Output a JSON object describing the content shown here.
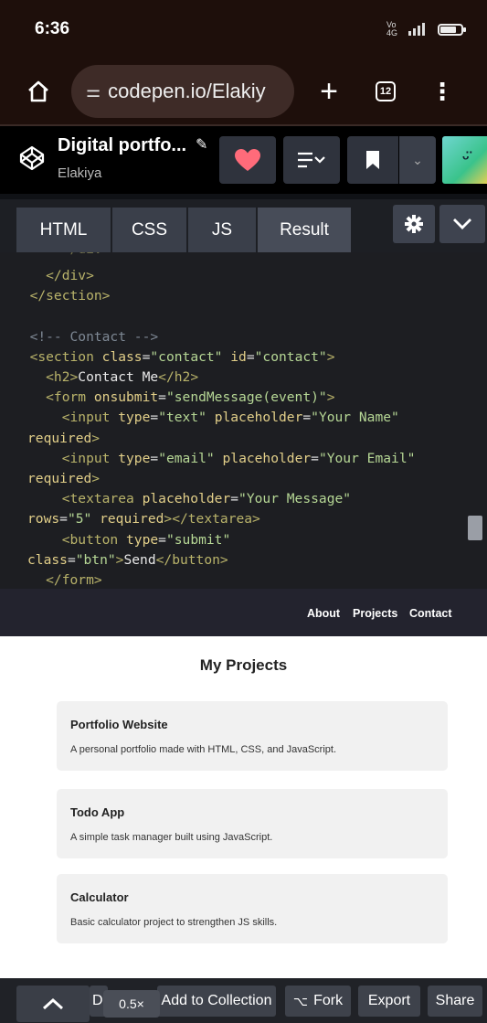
{
  "status_bar": {
    "time": "6:36",
    "network": "Vo 4G",
    "signal": "4G",
    "battery_level": 0.75
  },
  "browser": {
    "url": "codepen.io/Elakiy",
    "tab_count": "12"
  },
  "pen": {
    "title": "Digital portfo...",
    "author": "Elakiya"
  },
  "editor_tabs": [
    "HTML",
    "CSS",
    "JS",
    "Result"
  ],
  "code_lines": [
    [
      [
        "tok-cont",
        "      </div>"
      ]
    ],
    [
      [
        "tok-tag",
        "    </div>"
      ]
    ],
    [
      [
        "tok-tag",
        "  </section>"
      ]
    ],
    [
      [
        "tok-text",
        ""
      ]
    ],
    [
      [
        "tok-comment",
        "  <!-- Contact -->"
      ]
    ],
    [
      [
        "tok-tag",
        "  <section "
      ],
      [
        "tok-attr",
        "class"
      ],
      [
        "tok-text",
        "="
      ],
      [
        "tok-str",
        "\"contact\""
      ],
      [
        "tok-text",
        " "
      ],
      [
        "tok-attr",
        "id"
      ],
      [
        "tok-text",
        "="
      ],
      [
        "tok-str",
        "\"contact\""
      ],
      [
        "tok-tag",
        ">"
      ]
    ],
    [
      [
        "tok-tag",
        "    <h2>"
      ],
      [
        "tok-text",
        "Contact Me"
      ],
      [
        "tok-tag",
        "</h2>"
      ]
    ],
    [
      [
        "tok-tag",
        "    <form "
      ],
      [
        "tok-attr",
        "onsubmit"
      ],
      [
        "tok-text",
        "="
      ],
      [
        "tok-str",
        "\"sendMessage(event)\""
      ],
      [
        "tok-tag",
        ">"
      ]
    ],
    [
      [
        "tok-tag",
        "      <input "
      ],
      [
        "tok-attr",
        "type"
      ],
      [
        "tok-text",
        "="
      ],
      [
        "tok-str",
        "\"text\""
      ],
      [
        "tok-text",
        " "
      ],
      [
        "tok-attr",
        "placeholder"
      ],
      [
        "tok-text",
        "="
      ],
      [
        "tok-str",
        "\"Your Name\""
      ]
    ],
    [
      [
        "tok-attr",
        "required"
      ],
      [
        "tok-tag",
        ">"
      ]
    ],
    [
      [
        "tok-tag",
        "      <input "
      ],
      [
        "tok-attr",
        "type"
      ],
      [
        "tok-text",
        "="
      ],
      [
        "tok-str",
        "\"email\""
      ],
      [
        "tok-text",
        " "
      ],
      [
        "tok-attr",
        "placeholder"
      ],
      [
        "tok-text",
        "="
      ],
      [
        "tok-str",
        "\"Your Email\""
      ]
    ],
    [
      [
        "tok-attr",
        "required"
      ],
      [
        "tok-tag",
        ">"
      ]
    ],
    [
      [
        "tok-tag",
        "      <textarea "
      ],
      [
        "tok-attr",
        "placeholder"
      ],
      [
        "tok-text",
        "="
      ],
      [
        "tok-str",
        "\"Your Message\""
      ]
    ],
    [
      [
        "tok-attr",
        "rows"
      ],
      [
        "tok-text",
        "="
      ],
      [
        "tok-str",
        "\"5\""
      ],
      [
        "tok-text",
        " "
      ],
      [
        "tok-attr",
        "required"
      ],
      [
        "tok-tag",
        "></textarea>"
      ]
    ],
    [
      [
        "tok-tag",
        "      <button "
      ],
      [
        "tok-attr",
        "type"
      ],
      [
        "tok-text",
        "="
      ],
      [
        "tok-str",
        "\"submit\""
      ]
    ],
    [
      [
        "tok-attr",
        "class"
      ],
      [
        "tok-text",
        "="
      ],
      [
        "tok-str",
        "\"btn\""
      ],
      [
        "tok-tag",
        ">"
      ],
      [
        "tok-text",
        "Send"
      ],
      [
        "tok-tag",
        "</button>"
      ]
    ],
    [
      [
        "tok-tag",
        "    </form>"
      ]
    ]
  ],
  "preview": {
    "nav_links": [
      "About",
      "Projects",
      "Contact"
    ],
    "section_title": "My Projects",
    "projects": [
      {
        "title": "Portfolio Website",
        "description": "A personal portfolio made with HTML, CSS, and JavaScript."
      },
      {
        "title": "Todo App",
        "description": "A simple task manager built using JavaScript."
      },
      {
        "title": "Calculator",
        "description": "Basic calculator project to strengthen JS skills."
      }
    ]
  },
  "bottom_bar": {
    "zoom": "0.5×",
    "partial_label": "D",
    "add_to_collection": "Add to Collection",
    "fork": "Fork",
    "export": "Export",
    "share": "Share"
  },
  "colors": {
    "heart": "#ff6b7a",
    "panel": "#2f333d",
    "code_bg": "#1d1e22"
  }
}
